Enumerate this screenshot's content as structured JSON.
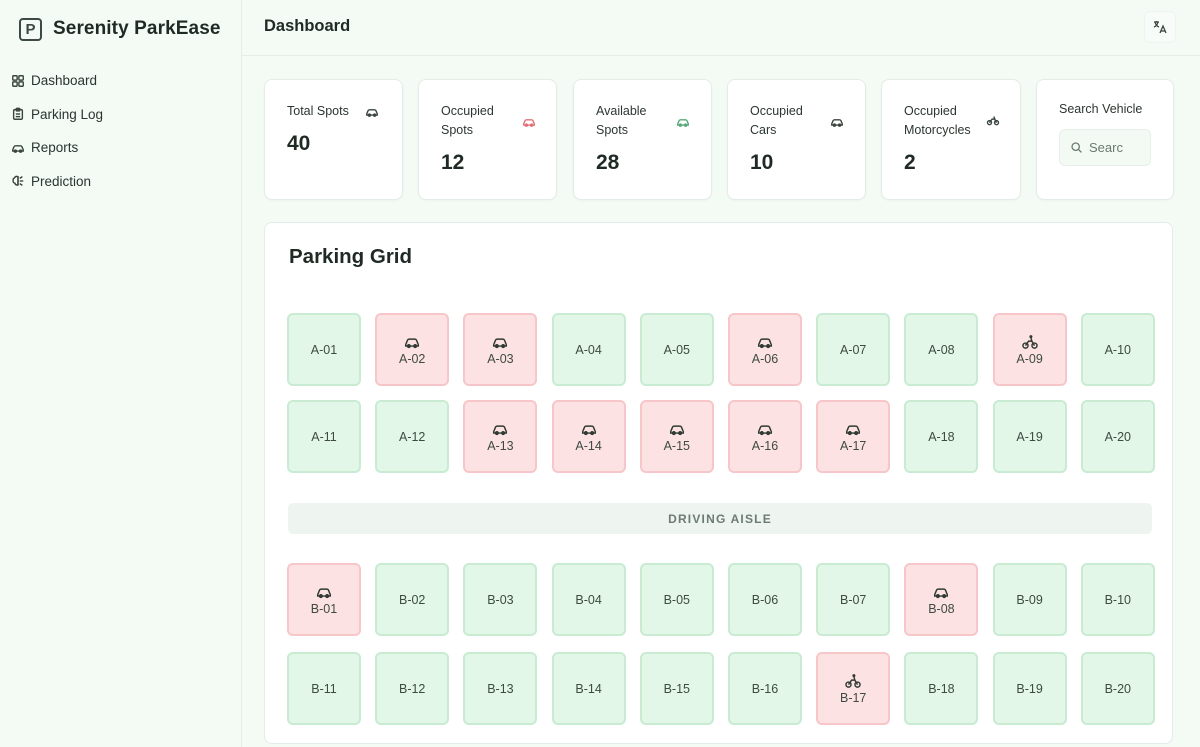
{
  "brand": {
    "logo_letter": "P",
    "name": "Serenity ParkEase"
  },
  "sidebar": {
    "items": [
      {
        "label": "Dashboard",
        "icon": "dashboard-grid-icon"
      },
      {
        "label": "Parking Log",
        "icon": "clipboard-icon"
      },
      {
        "label": "Reports",
        "icon": "car-icon"
      },
      {
        "label": "Prediction",
        "icon": "brain-icon"
      }
    ]
  },
  "header": {
    "title": "Dashboard",
    "translate_icon": "translate-icon"
  },
  "stats": {
    "total": {
      "label": "Total Spots",
      "value": "40"
    },
    "occupied": {
      "label_line1": "Occupied",
      "label_line2": "Spots",
      "value": "12"
    },
    "available": {
      "label_line1": "Available",
      "label_line2": "Spots",
      "value": "28"
    },
    "cars": {
      "label_line1": "Occupied",
      "label_line2": "Cars",
      "value": "10"
    },
    "motorcycles": {
      "label_line1": "Occupied",
      "label_line2": "Motorcycles",
      "value": "2"
    }
  },
  "search": {
    "label": "Search Vehicle",
    "placeholder": "Searc"
  },
  "grid": {
    "title": "Parking Grid",
    "aisle_label": "DRIVING AISLE",
    "colors": {
      "free": "#e2f7e8",
      "occupied": "#fde2e3"
    },
    "rows": [
      [
        {
          "id": "A-01",
          "status": "free"
        },
        {
          "id": "A-02",
          "status": "occupied",
          "vehicle": "car"
        },
        {
          "id": "A-03",
          "status": "occupied",
          "vehicle": "car"
        },
        {
          "id": "A-04",
          "status": "free"
        },
        {
          "id": "A-05",
          "status": "free"
        },
        {
          "id": "A-06",
          "status": "occupied",
          "vehicle": "car"
        },
        {
          "id": "A-07",
          "status": "free"
        },
        {
          "id": "A-08",
          "status": "free"
        },
        {
          "id": "A-09",
          "status": "occupied",
          "vehicle": "motorcycle"
        },
        {
          "id": "A-10",
          "status": "free"
        }
      ],
      [
        {
          "id": "A-11",
          "status": "free"
        },
        {
          "id": "A-12",
          "status": "free"
        },
        {
          "id": "A-13",
          "status": "occupied",
          "vehicle": "car"
        },
        {
          "id": "A-14",
          "status": "occupied",
          "vehicle": "car"
        },
        {
          "id": "A-15",
          "status": "occupied",
          "vehicle": "car"
        },
        {
          "id": "A-16",
          "status": "occupied",
          "vehicle": "car"
        },
        {
          "id": "A-17",
          "status": "occupied",
          "vehicle": "car"
        },
        {
          "id": "A-18",
          "status": "free"
        },
        {
          "id": "A-19",
          "status": "free"
        },
        {
          "id": "A-20",
          "status": "free"
        }
      ],
      [
        {
          "id": "B-01",
          "status": "occupied",
          "vehicle": "car"
        },
        {
          "id": "B-02",
          "status": "free"
        },
        {
          "id": "B-03",
          "status": "free"
        },
        {
          "id": "B-04",
          "status": "free"
        },
        {
          "id": "B-05",
          "status": "free"
        },
        {
          "id": "B-06",
          "status": "free"
        },
        {
          "id": "B-07",
          "status": "free"
        },
        {
          "id": "B-08",
          "status": "occupied",
          "vehicle": "car"
        },
        {
          "id": "B-09",
          "status": "free"
        },
        {
          "id": "B-10",
          "status": "free"
        }
      ],
      [
        {
          "id": "B-11",
          "status": "free"
        },
        {
          "id": "B-12",
          "status": "free"
        },
        {
          "id": "B-13",
          "status": "free"
        },
        {
          "id": "B-14",
          "status": "free"
        },
        {
          "id": "B-15",
          "status": "free"
        },
        {
          "id": "B-16",
          "status": "free"
        },
        {
          "id": "B-17",
          "status": "occupied",
          "vehicle": "motorcycle"
        },
        {
          "id": "B-18",
          "status": "free"
        },
        {
          "id": "B-19",
          "status": "free"
        },
        {
          "id": "B-20",
          "status": "free"
        }
      ]
    ]
  }
}
